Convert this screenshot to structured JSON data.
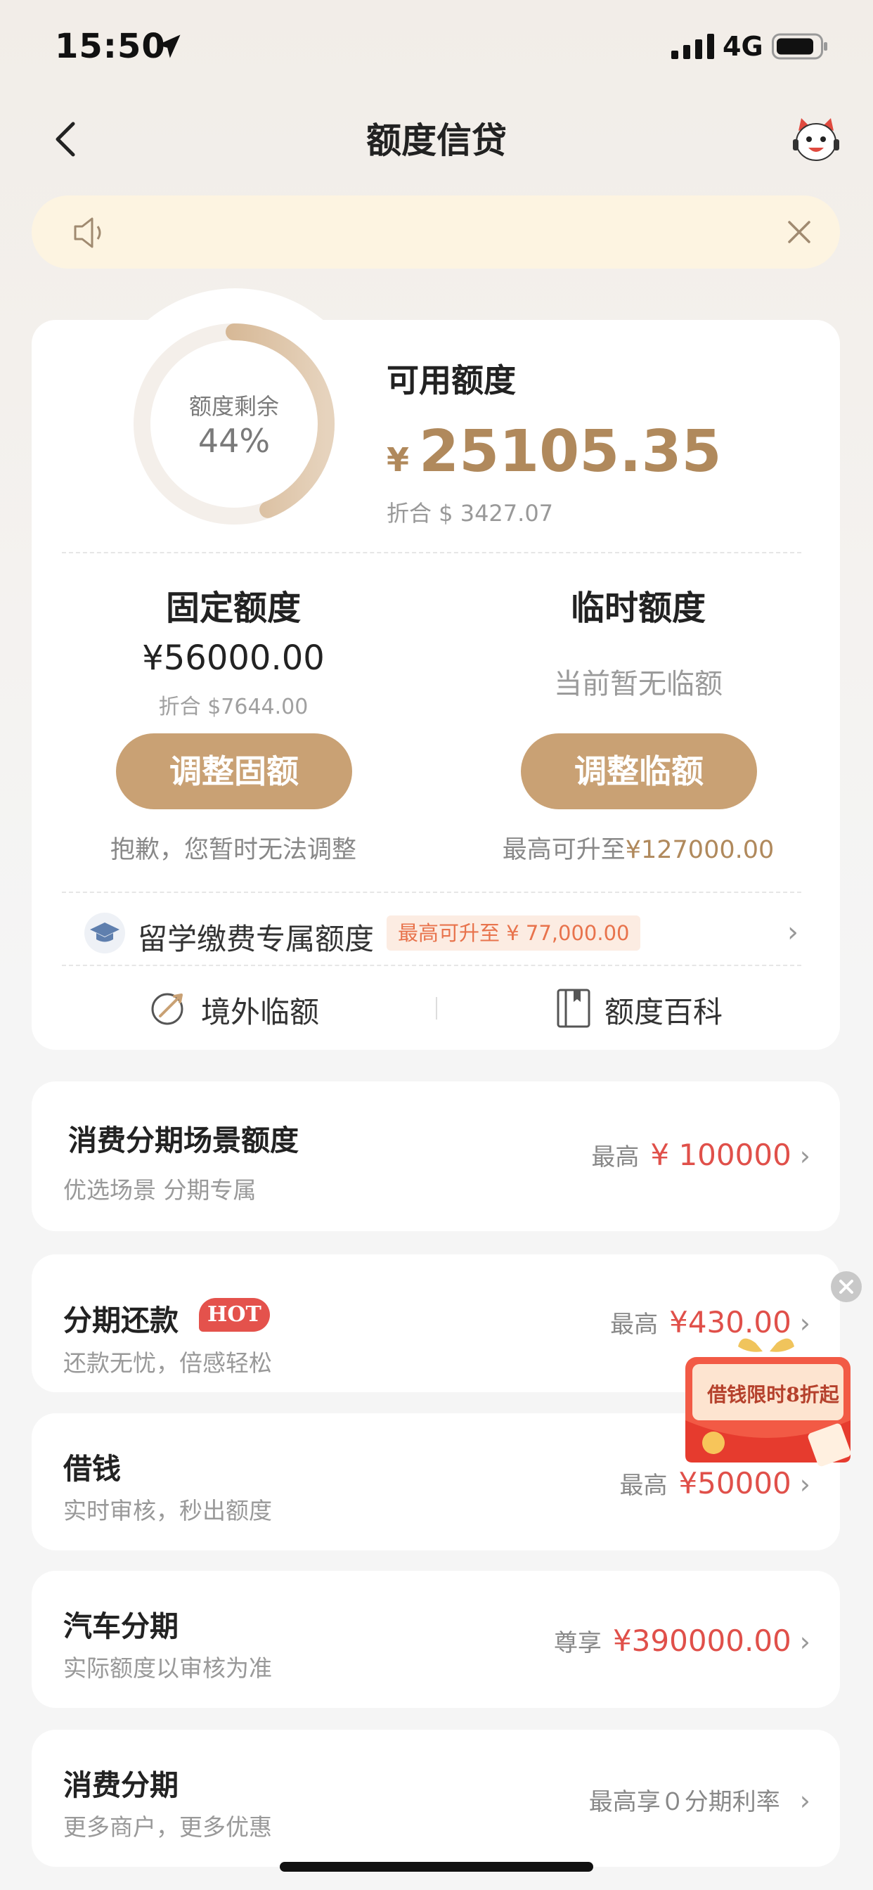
{
  "status_bar": {
    "time": "15:50",
    "network": "4G"
  },
  "nav": {
    "title": "额度信贷"
  },
  "notice": {
    "text": ""
  },
  "quota": {
    "ring_label": "额度剩余",
    "ring_percent": "44%",
    "remaining_fraction": 0.44,
    "available_title": "可用额度",
    "currency_symbol": "¥",
    "available_amount": "25105.35",
    "available_usd": "折合 $ 3427.07",
    "fixed_title": "固定额度",
    "fixed_amount": "¥56000.00",
    "fixed_usd": "折合 $7644.00",
    "fixed_button": "调整固额",
    "fixed_note": "抱歉，您暂时无法调整",
    "temp_title": "临时额度",
    "temp_none": "当前暂无临额",
    "temp_button": "调整临额",
    "temp_note_prefix": "最高可升至",
    "temp_note_amount": "¥127000.00",
    "study_label": "留学缴费专属额度",
    "study_tag": "最高可升至 ¥ 77,000.00",
    "abroad_label": "境外临额",
    "wiki_label": "额度百科"
  },
  "list": [
    {
      "title": "消费分期场景额度",
      "subtitle": "优选场景 分期专属",
      "prefix": "最高",
      "amount": "¥ 100000"
    },
    {
      "title": "分期还款",
      "badge": "HOT",
      "subtitle": "还款无忧，倍感轻松",
      "prefix": "最高",
      "amount": "¥430.00"
    },
    {
      "title": "借钱",
      "subtitle": "实时审核，秒出额度",
      "prefix": "最高",
      "amount": "¥50000"
    },
    {
      "title": "汽车分期",
      "subtitle": "实际额度以审核为准",
      "prefix": "尊享",
      "amount": "¥390000.00"
    },
    {
      "title": "消费分期",
      "subtitle": "更多商户，更多优惠",
      "prefix": "最高享０分期利率",
      "amount": ""
    }
  ],
  "promo": {
    "text": "借钱限时8折起"
  },
  "colors": {
    "gold": "#c9a174",
    "gold_text": "#b0895c",
    "red": "#e0504a",
    "notice_bg": "#fdf4e1"
  }
}
